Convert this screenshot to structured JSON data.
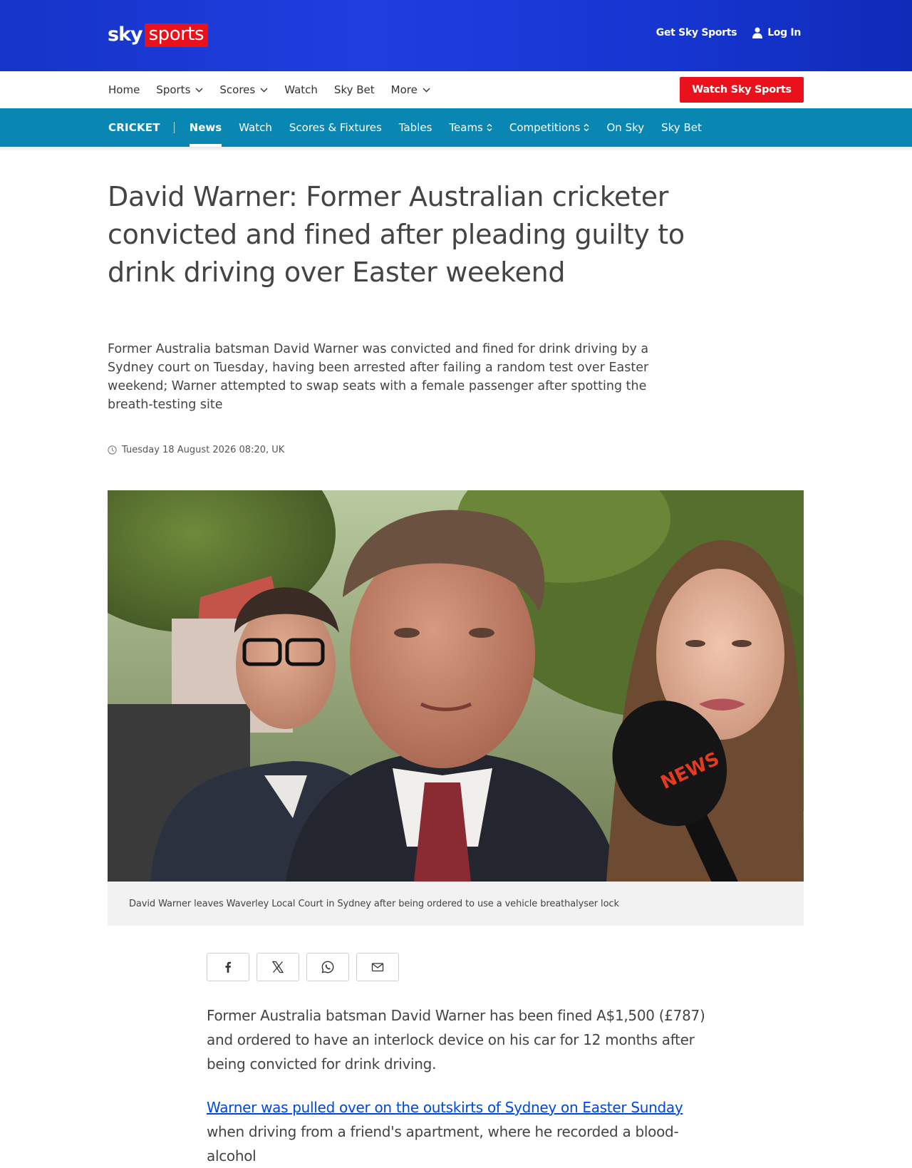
{
  "masthead": {
    "logo_sky": "sky",
    "logo_sports": "sports",
    "get_sky_sports": "Get Sky Sports",
    "log_in": "Log In",
    "colors": {
      "brand_blue": "#1a36d4",
      "brand_red": "#e8111c"
    }
  },
  "primary_nav": {
    "items": [
      "Home",
      "Sports",
      "Scores",
      "Watch",
      "Sky Bet",
      "More"
    ],
    "watch_button": "Watch Sky Sports"
  },
  "sub_nav": {
    "section": "CRICKET",
    "items": [
      "News",
      "Watch",
      "Scores & Fixtures",
      "Tables",
      "Teams",
      "Competitions",
      "On Sky",
      "Sky Bet"
    ],
    "active": "News",
    "color": "#0a86b3"
  },
  "article": {
    "headline": "David Warner: Former Australian cricketer convicted and fined after pleading guilty to drink driving over Easter weekend",
    "standfirst": "Former Australia batsman David Warner was convicted and fined for drink driving by a Sydney court on Tuesday, having been arrested after failing a random test over Easter weekend; Warner attempted to swap seats with a female passenger after spotting the breath-testing site",
    "timestamp": "Tuesday 18 August 2026 08:20, UK",
    "image_caption": "David Warner leaves Waverley Local Court in Sydney after being ordered to use a vehicle breathalyser lock",
    "microphone_text": "NEWS",
    "share_icons": [
      "facebook-icon",
      "x-icon",
      "whatsapp-icon",
      "email-icon"
    ],
    "paragraph_1": "Former Australia batsman David Warner has been fined A$1,500 (£787) and ordered to have an interlock device on his car for 12 months after being convicted for drink driving.",
    "paragraph_2_link": "Warner was pulled over on the outskirts of Sydney on Easter Sunday",
    "paragraph_2_rest": " when driving from a friend's apartment, where he recorded a blood-alcohol"
  }
}
